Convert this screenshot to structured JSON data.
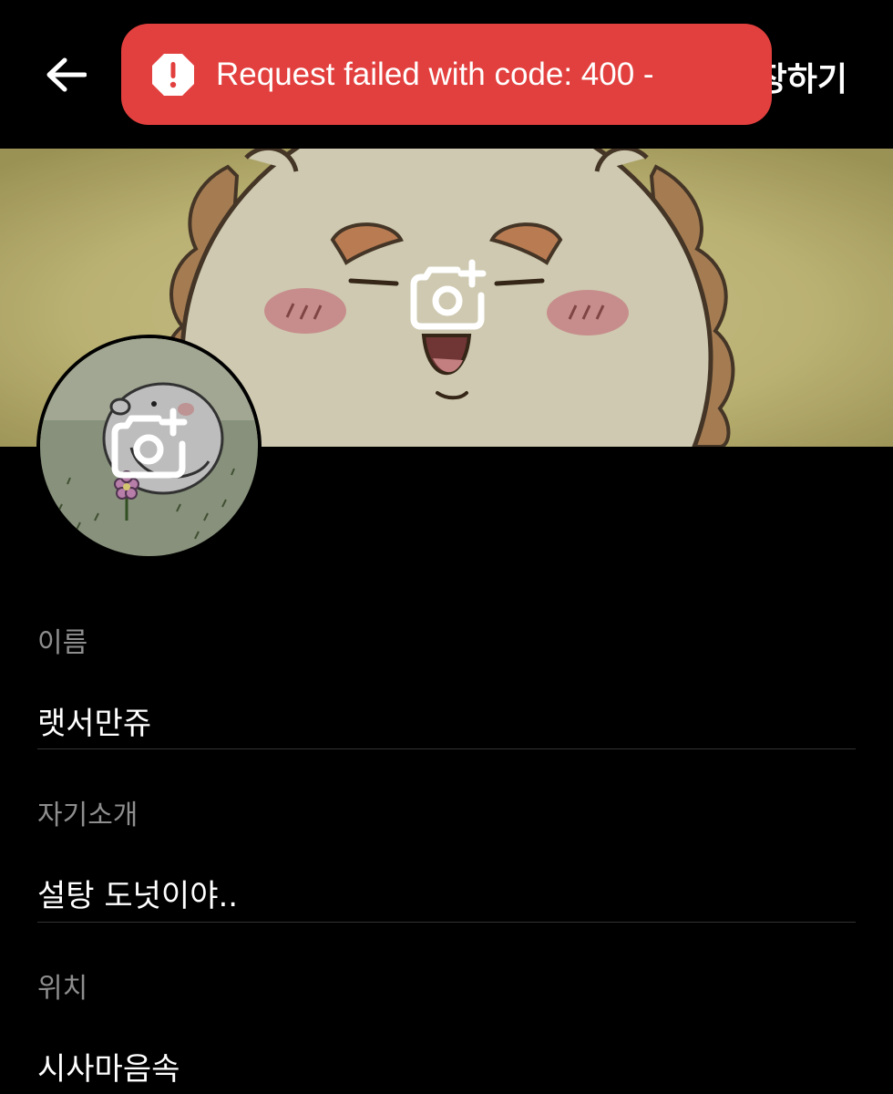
{
  "header": {
    "save_label": "장하기"
  },
  "toast": {
    "message": "Request failed with code: 400 -",
    "color": "#e2403e"
  },
  "icons": {
    "back": "arrow-left-icon",
    "alert": "alert-octagon-icon",
    "camera_add": "camera-plus-icon"
  },
  "fields": [
    {
      "label": "이름",
      "value": "랫서만쥬"
    },
    {
      "label": "자기소개",
      "value": "설탕 도넛이야.."
    },
    {
      "label": "위치",
      "value": "시사마음속"
    }
  ]
}
